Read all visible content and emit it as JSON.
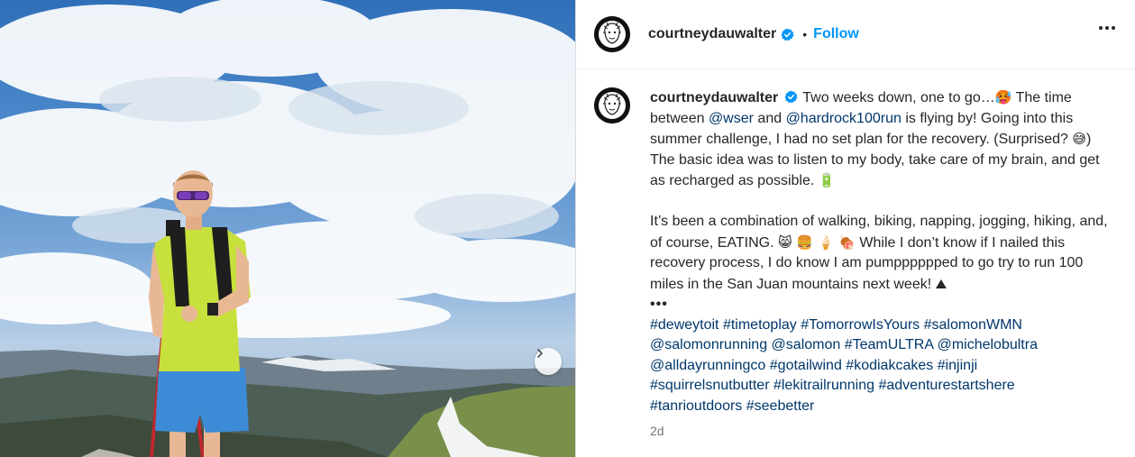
{
  "post": {
    "username": "courtneydauwalter",
    "follow_label": "Follow",
    "separator": "•",
    "caption": {
      "text_1": "Two weeks down, one to go…",
      "emoji_1": "🥵",
      "text_2": " The time between ",
      "mention_1": "@wser",
      "text_3": " and ",
      "mention_2": "@hardrock100run",
      "text_4": " is flying by! Going into this summer challenge, I had no set plan for the recovery. (Surprised? ",
      "emoji_2": "😅",
      "text_5": ") The basic idea was to listen to my body, take care of my brain, and get as recharged as possible. ",
      "emoji_3": "🔋",
      "para2_text_1": "It’s been a combination of walking, biking, napping, jogging, hiking, and, of course, EATING. ",
      "emoji_4": "😸 🍔 🍦 🍖",
      "para2_text_2": " While I don’t know if I nailed this recovery process, I do know I am pumpppppped to go try to run 100 miles in the San Juan mountains next week! ",
      "emoji_5": "⛰",
      "ellipsis": "•••",
      "hashtags": [
        "#deweytoit",
        "#timetoplay",
        "#TomorrowIsYours",
        "#salomonWMN"
      ],
      "hashtags_2": [
        "@salomonrunning",
        "@salomon",
        "#TeamULTRA",
        "@michelobultra"
      ],
      "hashtags_3": [
        "@alldayrunningco",
        "#gotailwind",
        "#kodiakcakes",
        "#injinji"
      ],
      "hashtags_4": [
        "#squirrelsnutbutter",
        "#lekitrailrunning",
        "#adventurestartshere"
      ],
      "hashtags_5": [
        "#tanrioutdoors",
        "#seebetter"
      ]
    },
    "timestamp": "2d"
  },
  "icons": {
    "verified": "verified-badge-icon",
    "more": "more-options-icon",
    "next": "chevron-right-icon"
  },
  "colors": {
    "accent": "#0095f6",
    "link": "#00376b",
    "verified": "#0095f6"
  }
}
